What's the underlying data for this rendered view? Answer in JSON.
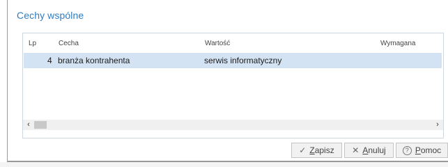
{
  "section": {
    "title": "Cechy wspólne"
  },
  "grid": {
    "columns": [
      "Lp",
      "Cecha",
      "Wartość",
      "Wymagana"
    ],
    "rows": [
      {
        "lp": "4",
        "cecha": "branża kontrahenta",
        "wartosc": "serwis informatyczny",
        "wymagana": ""
      }
    ],
    "scroll_left": "‹",
    "scroll_right": "›"
  },
  "footer": {
    "save": {
      "label": "Zapisz",
      "icon": "check-icon",
      "glyph": "✓"
    },
    "cancel": {
      "label": "Anuluj",
      "icon": "close-icon",
      "glyph": "✕"
    },
    "help": {
      "label": "Pomoc",
      "icon": "help-circle-icon",
      "glyph": "?"
    }
  }
}
